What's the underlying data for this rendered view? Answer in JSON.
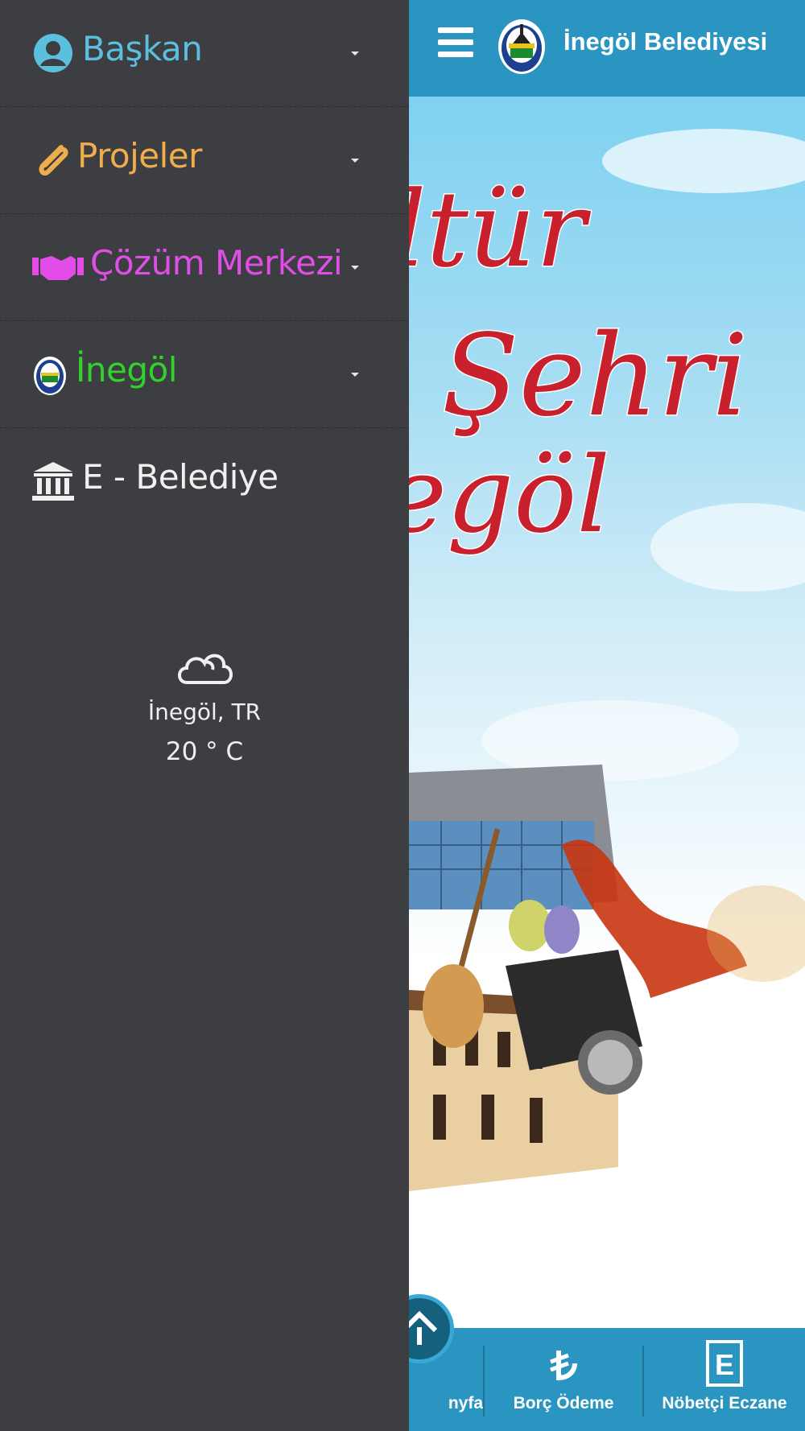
{
  "header": {
    "title": "İnegöl Belediyesi"
  },
  "drawer": {
    "menu": [
      {
        "label": "Başkan",
        "icon": "user-circle-icon",
        "color": "#5bc0de"
      },
      {
        "label": "Projeler",
        "icon": "paperclip-icon",
        "color": "#f0ad4e"
      },
      {
        "label": "Çözüm Merkezi",
        "icon": "handshake-icon",
        "color": "#e14de6"
      },
      {
        "label": "İnegöl",
        "icon": "inegol-logo-icon",
        "color": "#33d12d"
      },
      {
        "label": "E - Belediye",
        "icon": "bank-icon",
        "color": "#f0f0f0"
      }
    ],
    "weather": {
      "icon": "cloud-icon",
      "location": "İnegöl, TR",
      "temperature": "20 ° C"
    }
  },
  "hero": {
    "lines": [
      "ltür",
      "t Şehri",
      "egöl"
    ]
  },
  "bottom_nav": [
    {
      "label": "nyfa",
      "icon": "home-icon"
    },
    {
      "label": "Borç Ödeme",
      "icon": "lira-icon"
    },
    {
      "label": "Nöbetçi Eczane",
      "icon": "pharmacy-icon"
    }
  ],
  "colors": {
    "drawer_bg": "#3d3e41",
    "brand_blue": "#2a95c1",
    "hero_red": "#c8202d"
  }
}
